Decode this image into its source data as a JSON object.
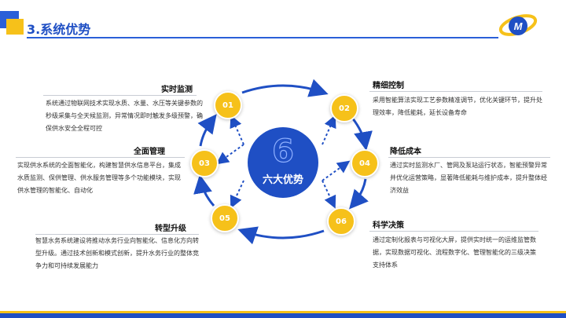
{
  "header": {
    "title": "3.系统优势"
  },
  "center": {
    "number": "6",
    "label": "六大优势"
  },
  "sections": [
    {
      "num": "01",
      "title": "实时监测",
      "text": "系统通过物联网技术实现水质、水量、水压等关键参数的秒级采集与全天候监测，异常情况即时触发多级预警，确保供水安全全程可控"
    },
    {
      "num": "02",
      "title": "精细控制",
      "text": "采用智能算法实现工艺参数精准调节，优化关键环节，提升处理效率，降低能耗，延长设备寿命"
    },
    {
      "num": "03",
      "title": "全面管理",
      "text": "实现供水系统的全面智能化，构建智慧供水信息平台，集成水质监测、保供管理、供水服务管理等多个功能模块，实现供水管理的智能化、自动化"
    },
    {
      "num": "04",
      "title": "降低成本",
      "text": "通过实时监测水厂、管网及泵站运行状态，智能预警异常并优化运营策略，显著降低能耗与维护成本，提升整体经济效益"
    },
    {
      "num": "05",
      "title": "转型升级",
      "text": "智慧水务系统建设将推动水务行业向智能化、信息化方向转型升级。通过技术创新和模式创新，提升水务行业的整体竞争力和可持续发展能力"
    },
    {
      "num": "06",
      "title": "科学决策",
      "text": "通过定制化报表与可视化大屏，提供实时统一的运维监管数据，实现数据可视化、流程数字化、管理智能化的三级决策支持体系"
    }
  ]
}
